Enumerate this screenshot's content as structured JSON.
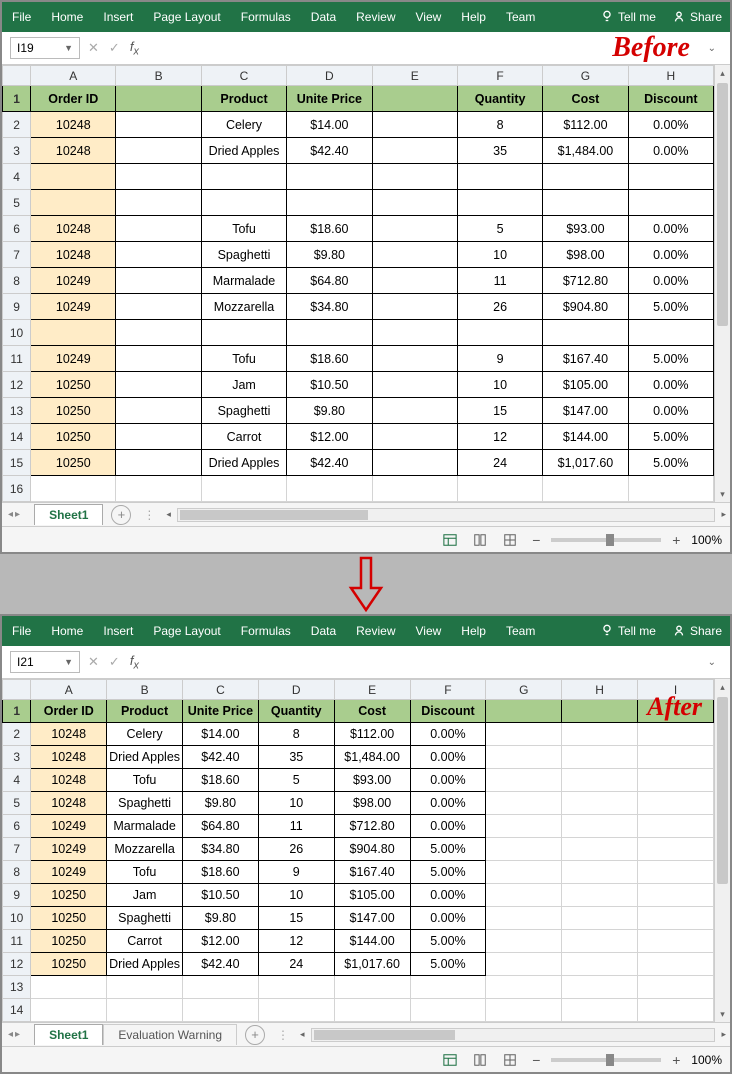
{
  "ribbon": {
    "tabs": [
      "File",
      "Home",
      "Insert",
      "Page Layout",
      "Formulas",
      "Data",
      "Review",
      "View",
      "Help",
      "Team"
    ],
    "tellme": "Tell me",
    "share": "Share"
  },
  "before": {
    "namebox": "I19",
    "annotation": "Before",
    "columns": [
      "A",
      "B",
      "C",
      "D",
      "E",
      "F",
      "G",
      "H"
    ],
    "headers": {
      "A": "Order ID",
      "B": "",
      "C": "Product",
      "D": "Unite Price",
      "E": "",
      "F": "Quantity",
      "G": "Cost",
      "H": "Discount"
    },
    "rows": [
      {
        "n": 1,
        "hdr": true
      },
      {
        "n": 2,
        "A": "10248",
        "C": "Celery",
        "D": "$14.00",
        "F": "8",
        "G": "$112.00",
        "H": "0.00%"
      },
      {
        "n": 3,
        "A": "10248",
        "C": "Dried Apples",
        "D": "$42.40",
        "F": "35",
        "G": "$1,484.00",
        "H": "0.00%"
      },
      {
        "n": 4,
        "blank": true
      },
      {
        "n": 5,
        "blank": true
      },
      {
        "n": 6,
        "A": "10248",
        "C": "Tofu",
        "D": "$18.60",
        "F": "5",
        "G": "$93.00",
        "H": "0.00%"
      },
      {
        "n": 7,
        "A": "10248",
        "C": "Spaghetti",
        "D": "$9.80",
        "F": "10",
        "G": "$98.00",
        "H": "0.00%"
      },
      {
        "n": 8,
        "A": "10249",
        "C": "Marmalade",
        "D": "$64.80",
        "F": "11",
        "G": "$712.80",
        "H": "0.00%"
      },
      {
        "n": 9,
        "A": "10249",
        "C": "Mozzarella",
        "D": "$34.80",
        "F": "26",
        "G": "$904.80",
        "H": "5.00%"
      },
      {
        "n": 10,
        "blank": true
      },
      {
        "n": 11,
        "A": "10249",
        "C": "Tofu",
        "D": "$18.60",
        "F": "9",
        "G": "$167.40",
        "H": "5.00%"
      },
      {
        "n": 12,
        "A": "10250",
        "C": "Jam",
        "D": "$10.50",
        "F": "10",
        "G": "$105.00",
        "H": "0.00%"
      },
      {
        "n": 13,
        "A": "10250",
        "C": "Spaghetti",
        "D": "$9.80",
        "F": "15",
        "G": "$147.00",
        "H": "0.00%"
      },
      {
        "n": 14,
        "A": "10250",
        "C": "Carrot",
        "D": "$12.00",
        "F": "12",
        "G": "$144.00",
        "H": "5.00%"
      },
      {
        "n": 15,
        "A": "10250",
        "C": "Dried Apples",
        "D": "$42.40",
        "F": "24",
        "G": "$1,017.60",
        "H": "5.00%"
      },
      {
        "n": 16,
        "empty": true
      }
    ],
    "sheet_tabs": [
      "Sheet1"
    ],
    "zoom": "100%"
  },
  "after": {
    "namebox": "I21",
    "annotation": "After",
    "columns": [
      "A",
      "B",
      "C",
      "D",
      "E",
      "F",
      "G",
      "H",
      "I"
    ],
    "headers": {
      "A": "Order ID",
      "B": "Product",
      "C": "Unite Price",
      "D": "Quantity",
      "E": "Cost",
      "F": "Discount"
    },
    "rows": [
      {
        "n": 1,
        "hdr": true
      },
      {
        "n": 2,
        "A": "10248",
        "B": "Celery",
        "C": "$14.00",
        "D": "8",
        "E": "$112.00",
        "F": "0.00%"
      },
      {
        "n": 3,
        "A": "10248",
        "B": "Dried Apples",
        "C": "$42.40",
        "D": "35",
        "E": "$1,484.00",
        "F": "0.00%"
      },
      {
        "n": 4,
        "A": "10248",
        "B": "Tofu",
        "C": "$18.60",
        "D": "5",
        "E": "$93.00",
        "F": "0.00%"
      },
      {
        "n": 5,
        "A": "10248",
        "B": "Spaghetti",
        "C": "$9.80",
        "D": "10",
        "E": "$98.00",
        "F": "0.00%"
      },
      {
        "n": 6,
        "A": "10249",
        "B": "Marmalade",
        "C": "$64.80",
        "D": "11",
        "E": "$712.80",
        "F": "0.00%"
      },
      {
        "n": 7,
        "A": "10249",
        "B": "Mozzarella",
        "C": "$34.80",
        "D": "26",
        "E": "$904.80",
        "F": "5.00%"
      },
      {
        "n": 8,
        "A": "10249",
        "B": "Tofu",
        "C": "$18.60",
        "D": "9",
        "E": "$167.40",
        "F": "5.00%"
      },
      {
        "n": 9,
        "A": "10250",
        "B": "Jam",
        "C": "$10.50",
        "D": "10",
        "E": "$105.00",
        "F": "0.00%"
      },
      {
        "n": 10,
        "A": "10250",
        "B": "Spaghetti",
        "C": "$9.80",
        "D": "15",
        "E": "$147.00",
        "F": "0.00%"
      },
      {
        "n": 11,
        "A": "10250",
        "B": "Carrot",
        "C": "$12.00",
        "D": "12",
        "E": "$144.00",
        "F": "5.00%"
      },
      {
        "n": 12,
        "A": "10250",
        "B": "Dried Apples",
        "C": "$42.40",
        "D": "24",
        "E": "$1,017.60",
        "F": "5.00%"
      },
      {
        "n": 13,
        "empty": true
      },
      {
        "n": 14,
        "empty": true
      }
    ],
    "sheet_tabs": [
      "Sheet1",
      "Evaluation Warning"
    ],
    "zoom": "100%"
  }
}
